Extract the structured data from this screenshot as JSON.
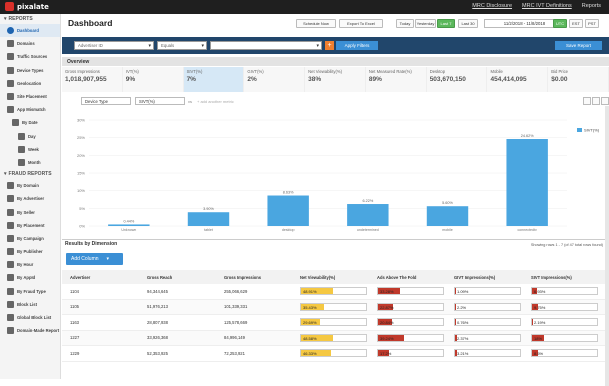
{
  "app": {
    "brand": "pixalate"
  },
  "topnav": {
    "mrc_disclosure": "MRC Disclosure",
    "mrc_ivt": "MRC IVT Definitions",
    "reports": "Reports"
  },
  "sidebar": {
    "reports_heading": "REPORTS",
    "items": [
      {
        "label": "Dashboard",
        "level": 0,
        "active": true
      },
      {
        "label": "Domains",
        "level": 0
      },
      {
        "label": "Traffic Sources",
        "level": 0
      },
      {
        "label": "Device Types",
        "level": 0
      },
      {
        "label": "Geolocation",
        "level": 0
      },
      {
        "label": "Site Placement",
        "level": 0
      },
      {
        "label": "App Mismatch",
        "level": 0
      },
      {
        "label": "By Date",
        "level": 1
      },
      {
        "label": "Day",
        "level": 2
      },
      {
        "label": "Week",
        "level": 2
      },
      {
        "label": "Month",
        "level": 2
      }
    ],
    "fraud_heading": "FRAUD REPORTS",
    "fraud_items": [
      {
        "label": "By Domain"
      },
      {
        "label": "By Advertiser"
      },
      {
        "label": "By Seller"
      },
      {
        "label": "By Placement"
      },
      {
        "label": "By Campaign"
      },
      {
        "label": "By Publisher"
      },
      {
        "label": "By Hour"
      },
      {
        "label": "By AppId"
      },
      {
        "label": "By Fraud Type"
      },
      {
        "label": "Block List"
      },
      {
        "label": "Global Block List"
      },
      {
        "label": "Domain-Made Report"
      }
    ]
  },
  "header": {
    "title": "Dashboard",
    "schedule_now": "Schedule Now",
    "export_excel": "Export To Excel",
    "ranges": [
      "Today",
      "Yesterday",
      "Last 7",
      "Last 30"
    ],
    "active_range": "Last 7",
    "date_range": "11/2/2018 - 11/8/2018",
    "timezones": [
      "UTC",
      "EST",
      "PST"
    ],
    "active_tz": "UTC"
  },
  "filters": {
    "field": "Advertiser ID",
    "operator": "Equals",
    "value": "",
    "apply_label": "Apply Filters",
    "save_label": "Save Report"
  },
  "overview": {
    "heading": "Overview",
    "metrics": [
      {
        "label": "Gross Impressions",
        "value": "1,018,907,955",
        "selected": false
      },
      {
        "label": "IVT(%)",
        "value": "9%",
        "selected": false
      },
      {
        "label": "SIVT(%)",
        "value": "7%",
        "selected": true
      },
      {
        "label": "GIVT(%)",
        "value": "2%",
        "selected": false
      },
      {
        "label": "Net Viewability(%)",
        "value": "38%",
        "selected": false
      },
      {
        "label": "Net Measured Rate(%)",
        "value": "89%",
        "selected": false
      },
      {
        "label": "Desktop",
        "value": "503,670,150",
        "selected": false
      },
      {
        "label": "Mobile",
        "value": "454,414,095",
        "selected": false
      },
      {
        "label": "Bid Price",
        "value": "$0.00",
        "selected": false
      }
    ]
  },
  "chart_controls": {
    "dimension": "Device Type",
    "metric": "SIVT(%)",
    "vs": "vs",
    "add_metric": "+ add another metric"
  },
  "chart_data": {
    "type": "bar",
    "categories": [
      "Unknown",
      "tablet",
      "desktop",
      "undetermined",
      "mobile",
      "connectedtv"
    ],
    "series": [
      {
        "name": "SIVT(%)",
        "values": [
          0.44,
          3.9,
          8.63,
          6.22,
          5.6,
          24.62
        ]
      }
    ],
    "data_labels": [
      "0.44%",
      "3.90%",
      "8.63%",
      "6.22%",
      "5.60%",
      "24.62%"
    ],
    "ylim": [
      0,
      30
    ],
    "yticks": [
      "0%",
      "5%",
      "10%",
      "15%",
      "20%",
      "25%",
      "30%"
    ],
    "legend": "top-right",
    "color": "#4aa6e0"
  },
  "results": {
    "heading": "Results by Dimension",
    "showing": "Showing rows 1 - 7 (of 47 total rows found)",
    "add_column": "Add Column",
    "columns": [
      "Advertiser",
      "Gross Reach",
      "Gross Impressions",
      "Net Viewability(%)",
      "Ads Above The Fold",
      "GIVT Impressions(%)",
      "SIVT Impressions(%)"
    ],
    "rows": [
      {
        "advertiser": "1104",
        "reach": "94,344,645",
        "impr": "255,066,629",
        "view": "48.91%",
        "view_v": 0.4891,
        "fold": "33.28%",
        "fold_v": 0.3328,
        "givt": "1.09%",
        "givt_v": 0.0109,
        "sivt": "6.93%",
        "sivt_v": 0.0693
      },
      {
        "advertiser": "1105",
        "reach": "51,976,213",
        "impr": "101,339,331",
        "view": "35.43%",
        "view_v": 0.3543,
        "fold": "22.87%",
        "fold_v": 0.2287,
        "givt": "2.2%",
        "givt_v": 0.022,
        "sivt": "9.75%",
        "sivt_v": 0.0975
      },
      {
        "advertiser": "1163",
        "reach": "28,807,938",
        "impr": "125,578,669",
        "view": "29.69%",
        "view_v": 0.2969,
        "fold": "20.84%",
        "fold_v": 0.2084,
        "givt": "0.76%",
        "givt_v": 0.0076,
        "sivt": "2.19%",
        "sivt_v": 0.0219
      },
      {
        "advertiser": "1227",
        "reach": "33,926,368",
        "impr": "84,996,149",
        "view": "48.58%",
        "view_v": 0.4858,
        "fold": "39.24%",
        "fold_v": 0.3924,
        "givt": "2.37%",
        "givt_v": 0.0237,
        "sivt": "18%",
        "sivt_v": 0.18
      },
      {
        "advertiser": "1229",
        "reach": "52,353,925",
        "impr": "72,253,921",
        "view": "46.33%",
        "view_v": 0.4633,
        "fold": "17.2%",
        "fold_v": 0.172,
        "givt": "3.21%",
        "givt_v": 0.0321,
        "sivt": "8.5%",
        "sivt_v": 0.085
      }
    ]
  }
}
